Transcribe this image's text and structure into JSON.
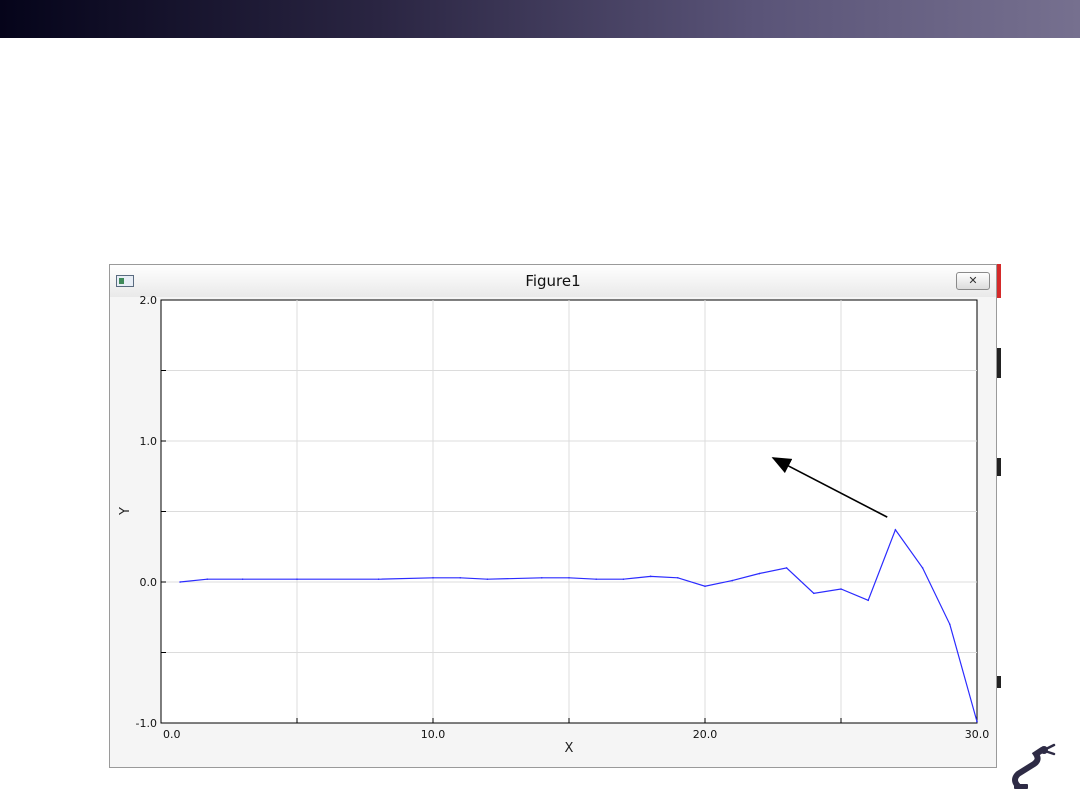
{
  "window": {
    "title": "Figure1",
    "close_glyph": "✕",
    "icon": "window-icon"
  },
  "logo": {
    "icon": "robot-arm-logo-icon"
  },
  "colors": {
    "line": "#2b2bff",
    "grid": "#dcdcdc",
    "banner": "#5a5478"
  },
  "chart_data": {
    "type": "line",
    "title": "",
    "xlabel": "X",
    "ylabel": "Y",
    "xlim": [
      0,
      30
    ],
    "ylim": [
      -1,
      2
    ],
    "x_ticks": [
      0,
      10,
      20,
      30
    ],
    "x_tick_labels": [
      "0.0",
      "10.0",
      "20.0",
      "30.0"
    ],
    "y_ticks": [
      -1,
      0,
      1,
      2
    ],
    "y_tick_labels": [
      "-1.0",
      "0.0",
      "1.0",
      "2.0"
    ],
    "grid": true,
    "series": [
      {
        "x": [
          0.7,
          1.7,
          3,
          5,
          8,
          10,
          11,
          12,
          14,
          15,
          16,
          17,
          18,
          19,
          20,
          21,
          22,
          23,
          24,
          25,
          26,
          27,
          28,
          29,
          30
        ],
        "y": [
          0.0,
          0.02,
          0.02,
          0.02,
          0.02,
          0.03,
          0.03,
          0.02,
          0.03,
          0.03,
          0.02,
          0.02,
          0.04,
          0.03,
          -0.03,
          0.01,
          0.06,
          0.1,
          -0.08,
          -0.05,
          -0.13,
          0.37,
          0.1,
          -0.3,
          -0.99
        ]
      }
    ],
    "annotation": {
      "type": "arrow",
      "from": [
        26.7,
        0.46
      ],
      "to": [
        22.5,
        0.88
      ]
    }
  }
}
